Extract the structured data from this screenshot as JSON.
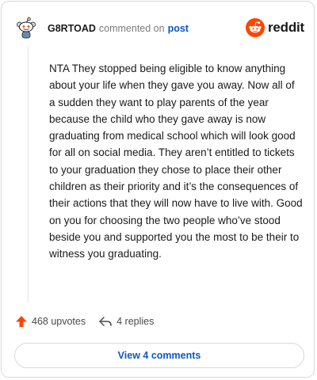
{
  "header": {
    "username": "G8RTOAD",
    "commented_text": "commented on",
    "post_link": "post",
    "brand": "reddit"
  },
  "comment": {
    "text": "NTA They stopped being eligible to know anything about your life when they gave you away. Now all of a sudden they want to play parents of the year because the child who they gave away is now graduating from medical school which will look good for all on social media. They aren’t entitled to tickets to your graduation they chose to place their other children as their priority and it’s the consequences of their actions that they will now have to live with. Good on you for choosing the two people who’ve stood beside you and supported you the most to be their to witness you graduating."
  },
  "actions": {
    "upvotes": "468 upvotes",
    "replies": "4 replies",
    "upvote_icon": "upvote-arrow-icon",
    "reply_icon": "reply-arrow-icon"
  },
  "footer": {
    "view_comments": "View 4 comments"
  },
  "colors": {
    "brand_orange": "#ff4500",
    "link_blue": "#0b57d0",
    "border": "#d7d9dc"
  }
}
